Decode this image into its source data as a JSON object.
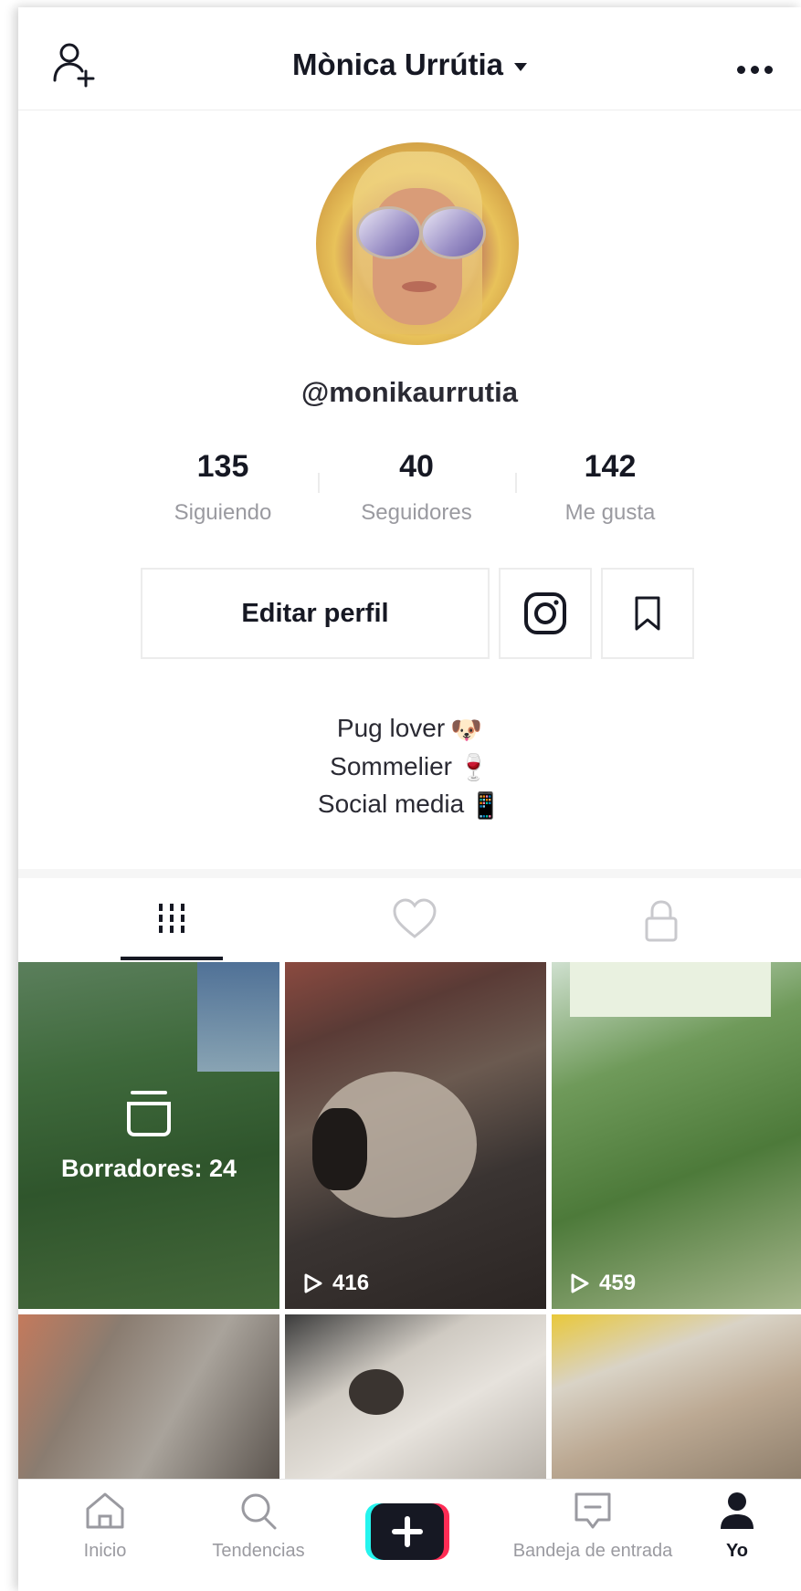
{
  "header": {
    "title": "Mònica Urrútia",
    "add_user_icon": "add-user-icon",
    "more_icon": "more-icon"
  },
  "profile": {
    "username": "@monikaurrutia"
  },
  "stats": [
    {
      "value": "135",
      "label": "Siguiendo"
    },
    {
      "value": "40",
      "label": "Seguidores"
    },
    {
      "value": "142",
      "label": "Me gusta"
    }
  ],
  "actions": {
    "edit_label": "Editar perfil",
    "instagram_icon": "instagram-icon",
    "bookmark_icon": "bookmark-icon"
  },
  "bio": {
    "lines": [
      {
        "text": "Pug lover",
        "emoji": "🐶"
      },
      {
        "text": "Sommelier",
        "emoji": "🍷"
      },
      {
        "text": "Social media",
        "emoji": "📱"
      }
    ]
  },
  "tabs": [
    {
      "name": "videos",
      "icon": "grid-icon",
      "active": true
    },
    {
      "name": "liked",
      "icon": "heart-icon",
      "active": false
    },
    {
      "name": "private",
      "icon": "lock-icon",
      "active": false
    }
  ],
  "grid": {
    "drafts_label": "Borradores: 24",
    "videos": [
      {
        "views": "416"
      },
      {
        "views": "459"
      }
    ]
  },
  "nav": [
    {
      "label": "Inicio",
      "icon": "home-icon"
    },
    {
      "label": "Tendencias",
      "icon": "search-icon"
    },
    {
      "label": "",
      "icon": "plus-icon"
    },
    {
      "label": "Bandeja de entrada",
      "icon": "inbox-icon"
    },
    {
      "label": "Yo",
      "icon": "profile-icon"
    }
  ],
  "colors": {
    "plus_left": "#25f4ee",
    "plus_right": "#fe2c55",
    "text": "#161823",
    "muted": "#9a9aa0"
  }
}
